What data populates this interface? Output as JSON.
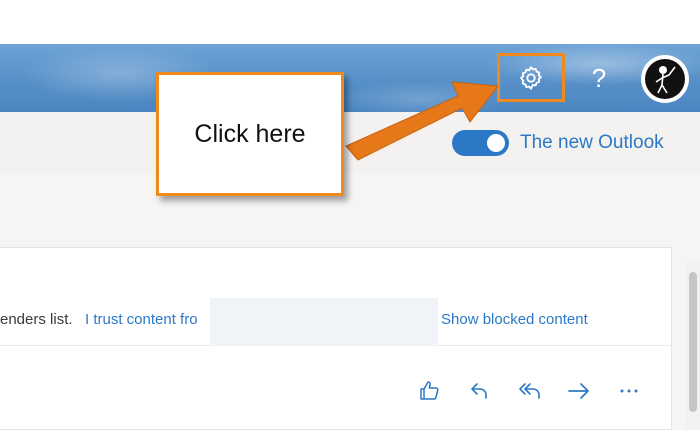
{
  "header": {
    "settings_icon": "gear-icon",
    "help_label": "?",
    "avatar_icon": "avatar"
  },
  "commandbar": {
    "toggle_state": "on",
    "toggle_label": "The new Outlook"
  },
  "message": {
    "notice_text": "enders list.",
    "trust_link": "I trust content fro",
    "blocked_link": "Show blocked content",
    "actions": [
      {
        "name": "like-icon"
      },
      {
        "name": "reply-icon"
      },
      {
        "name": "reply-all-icon"
      },
      {
        "name": "forward-icon"
      },
      {
        "name": "more-icon",
        "label": "···"
      }
    ]
  },
  "annotation": {
    "callout_text": "Click here",
    "highlight_color": "#f08a1e"
  },
  "colors": {
    "accent": "#2b79c6",
    "header": "#5790c8"
  }
}
